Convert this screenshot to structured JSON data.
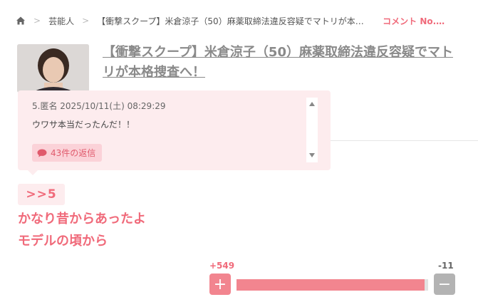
{
  "breadcrumb": {
    "category": "芸能人",
    "article": "【衝撃スクープ】米倉涼子（50）麻薬取締法違反容疑でマトリが本格捜…",
    "comment_label": "コメント No.…"
  },
  "article": {
    "title": "【衝撃スクープ】米倉涼子（50）麻薬取締法違反容疑でマトリが本格捜査へ！"
  },
  "popup": {
    "meta": "5.匿名 2025/10/11(土) 08:29:29",
    "text": "ウワサ本当だったんだ！！",
    "replies_label": "43件の返信"
  },
  "reply": {
    "anchor": ">>5",
    "lines": [
      "かなり昔からあったよ",
      "モデルの頃から"
    ]
  },
  "vote": {
    "plus_count": "+549",
    "minus_count": "-11",
    "plus_symbol": "+",
    "minus_symbol": "−",
    "plus_fraction": 0.98
  },
  "colors": {
    "accent": "#f06a7a",
    "popup_bg": "#fdecee",
    "minus_button": "#b3b3b3"
  },
  "icons": [
    "home-icon",
    "chevron-right-icon",
    "chat-bubble-icon",
    "scroll-up-icon",
    "scroll-down-icon"
  ]
}
